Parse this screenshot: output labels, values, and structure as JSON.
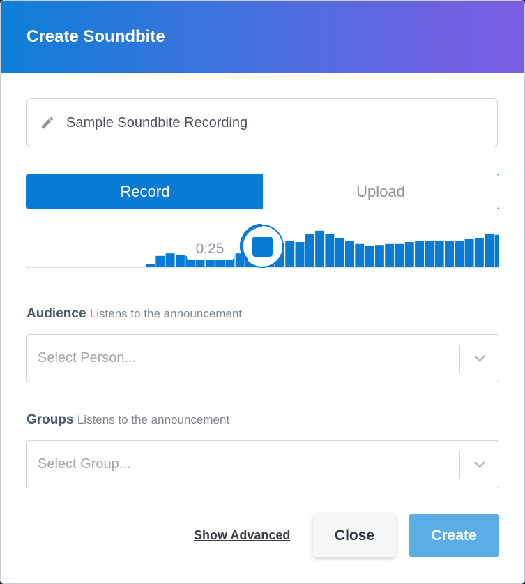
{
  "modal": {
    "title": "Create Soundbite"
  },
  "name_field": {
    "value": "Sample Soundbite Recording",
    "icon": "pencil-icon"
  },
  "mode_toggle": {
    "record_label": "Record",
    "upload_label": "Upload",
    "selected": "Record"
  },
  "recorder": {
    "elapsed": "0:25",
    "stop_icon": "stop-icon",
    "levels": [
      0.07,
      0.27,
      0.33,
      0.3,
      0.27,
      0.27,
      0.33,
      0.3,
      0.3,
      0.33,
      0.57,
      0.6,
      0.7,
      0.57,
      0.63,
      0.6,
      0.8,
      0.87,
      0.8,
      0.7,
      0.63,
      0.57,
      0.5,
      0.53,
      0.57,
      0.57,
      0.6,
      0.63,
      0.63,
      0.63,
      0.63,
      0.63,
      0.67,
      0.7,
      0.8,
      0.77,
      0.7,
      0.63,
      0.6,
      0.57,
      0.6
    ]
  },
  "audience": {
    "label": "Audience",
    "hint": "Listens to the announcement",
    "placeholder": "Select Person..."
  },
  "groups": {
    "label": "Groups",
    "hint": "Listens to the announcement",
    "placeholder": "Select Group..."
  },
  "footer": {
    "show_advanced": "Show Advanced",
    "close": "Close",
    "create": "Create"
  },
  "colors": {
    "primary": "#0a7bd4",
    "create_button": "#5aaee5"
  }
}
